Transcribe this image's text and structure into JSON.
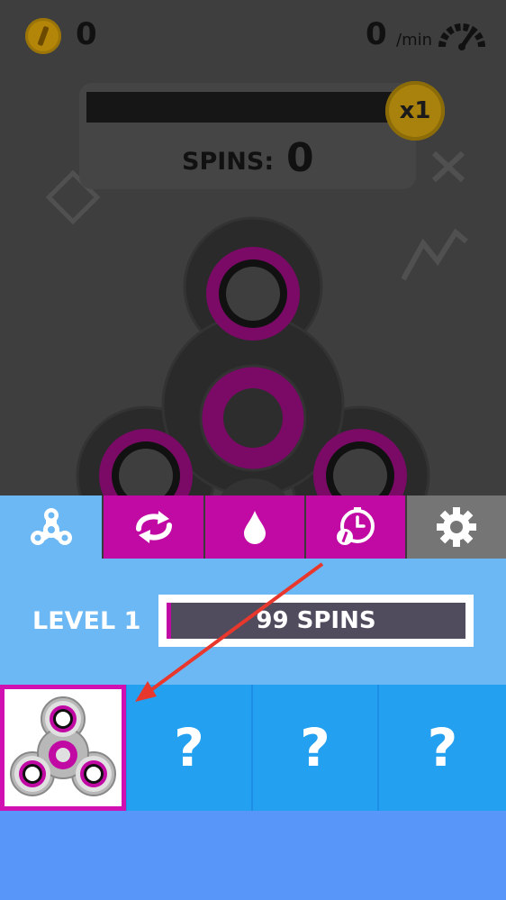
{
  "hud": {
    "coins": "0",
    "rate_value": "0",
    "rate_unit": "/min",
    "multiplier": "x1",
    "spins_label": "SPINS:",
    "spins_value": "0"
  },
  "icons": {
    "coin": "coin-icon",
    "speed": "speedometer-icon",
    "tabs": [
      "fidget-spinner-icon",
      "rotate-icon",
      "drop-icon",
      "timer-icon",
      "gear-icon"
    ]
  },
  "level": {
    "label": "LEVEL 1",
    "progress_text": "99 SPINS",
    "progress_fraction": 0.0
  },
  "unlock_slots": [
    {
      "locked": false
    },
    {
      "locked": true,
      "label": "?"
    },
    {
      "locked": true,
      "label": "?"
    },
    {
      "locked": true,
      "label": "?"
    }
  ],
  "colors": {
    "accent_magenta": "#c109a3",
    "light_blue": "#6cb8f4",
    "slot_blue": "#24a0f0",
    "bottom_blue": "#5896fa",
    "arrow_red": "#e8372c"
  }
}
